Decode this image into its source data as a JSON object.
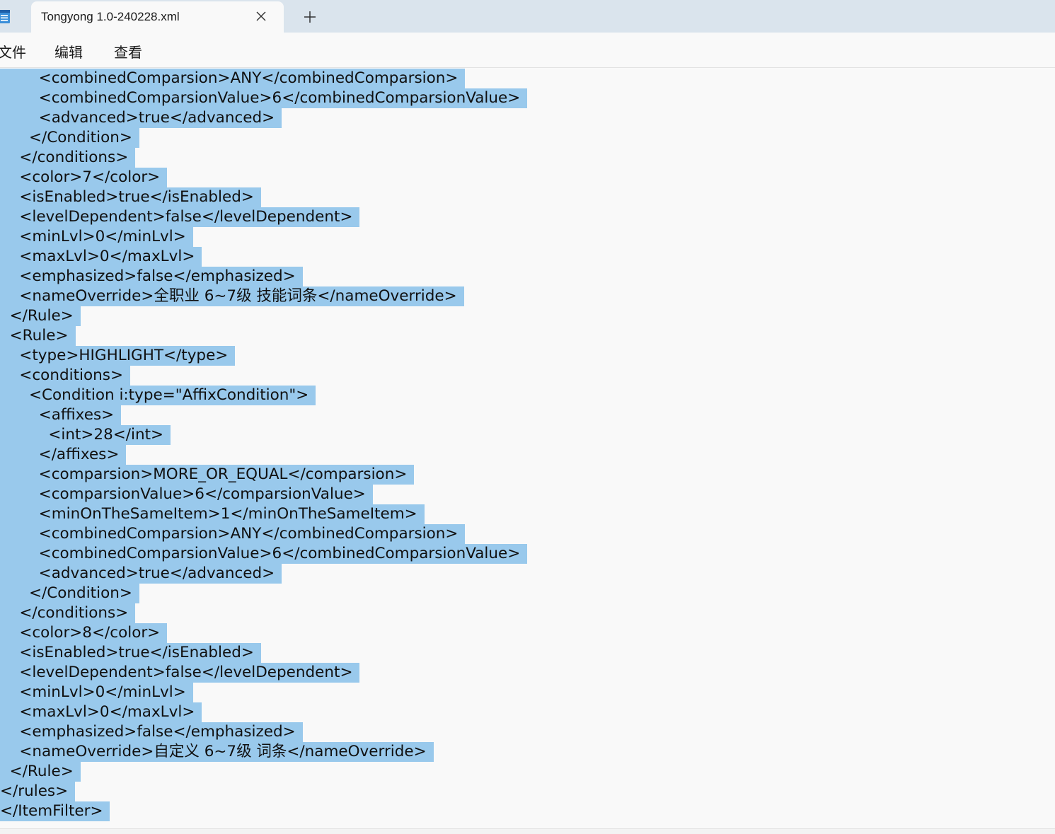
{
  "tab": {
    "title": "Tongyong 1.0-240228.xml",
    "close_icon": "close-icon",
    "new_tab_icon": "plus-icon"
  },
  "app": {
    "icon": "notepad-icon"
  },
  "menu": {
    "file": "文件",
    "edit": "编辑",
    "view": "查看"
  },
  "colors": {
    "selection": "#99c9ec",
    "tabbar": "#dae4ed",
    "background": "#f9f9f9"
  },
  "editor": {
    "lines": [
      "        <combinedComparsion>ANY</combinedComparsion>",
      "        <combinedComparsionValue>6</combinedComparsionValue>",
      "        <advanced>true</advanced>",
      "      </Condition>",
      "    </conditions>",
      "    <color>7</color>",
      "    <isEnabled>true</isEnabled>",
      "    <levelDependent>false</levelDependent>",
      "    <minLvl>0</minLvl>",
      "    <maxLvl>0</maxLvl>",
      "    <emphasized>false</emphasized>",
      "    <nameOverride>全职业 6~7级 技能词条</nameOverride>",
      "  </Rule>",
      "  <Rule>",
      "    <type>HIGHLIGHT</type>",
      "    <conditions>",
      "      <Condition i:type=\"AffixCondition\">",
      "        <affixes>",
      "          <int>28</int>",
      "        </affixes>",
      "        <comparsion>MORE_OR_EQUAL</comparsion>",
      "        <comparsionValue>6</comparsionValue>",
      "        <minOnTheSameItem>1</minOnTheSameItem>",
      "        <combinedComparsion>ANY</combinedComparsion>",
      "        <combinedComparsionValue>6</combinedComparsionValue>",
      "        <advanced>true</advanced>",
      "      </Condition>",
      "    </conditions>",
      "    <color>8</color>",
      "    <isEnabled>true</isEnabled>",
      "    <levelDependent>false</levelDependent>",
      "    <minLvl>0</minLvl>",
      "    <maxLvl>0</maxLvl>",
      "    <emphasized>false</emphasized>",
      "    <nameOverride>自定义 6~7级 词条</nameOverride>",
      "  </Rule>",
      "</rules>",
      "</ItemFilter>"
    ]
  }
}
